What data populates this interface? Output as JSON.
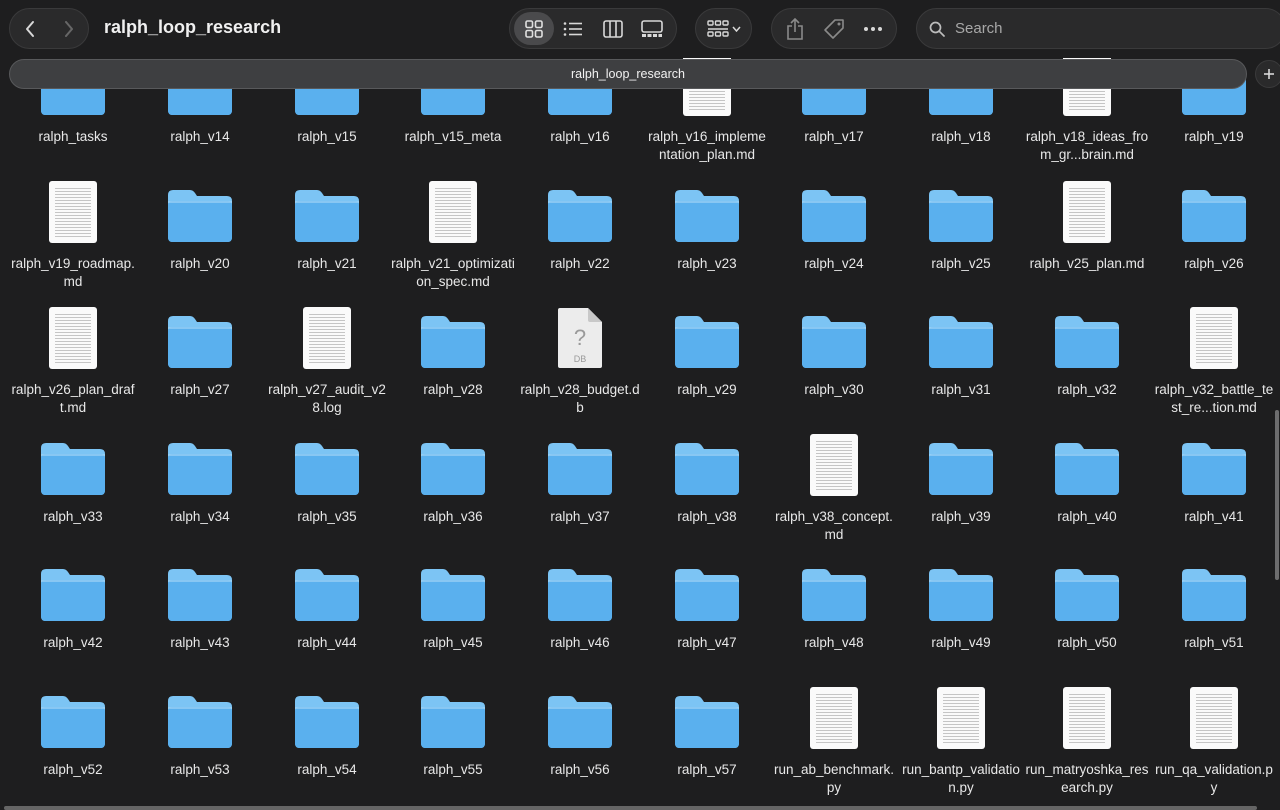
{
  "toolbar": {
    "window_title": "ralph_loop_research",
    "back_icon": "chevron-left-icon",
    "forward_icon": "chevron-right-icon",
    "search_placeholder": "Search"
  },
  "tab": {
    "label": "ralph_loop_research",
    "add_label": "+"
  },
  "colors": {
    "folder": "#5ab0ee",
    "folder_top": "#7cc4f4",
    "background": "#1e1e1f",
    "tabbar": "#3e3f41"
  },
  "rows": [
    [
      {
        "name": "ralph_tasks",
        "kind": "folder"
      },
      {
        "name": "ralph_v14",
        "kind": "folder"
      },
      {
        "name": "ralph_v15",
        "kind": "folder"
      },
      {
        "name": "ralph_v15_meta",
        "kind": "folder"
      },
      {
        "name": "ralph_v16",
        "kind": "folder"
      },
      {
        "name": "ralph_v16_implementation_plan.md",
        "kind": "doc"
      },
      {
        "name": "ralph_v17",
        "kind": "folder"
      },
      {
        "name": "ralph_v18",
        "kind": "folder"
      },
      {
        "name": "ralph_v18_ideas_from_gr...brain.md",
        "kind": "doc"
      },
      {
        "name": "ralph_v19",
        "kind": "folder"
      }
    ],
    [
      {
        "name": "ralph_v19_roadmap.md",
        "kind": "doc"
      },
      {
        "name": "ralph_v20",
        "kind": "folder"
      },
      {
        "name": "ralph_v21",
        "kind": "folder"
      },
      {
        "name": "ralph_v21_optimization_spec.md",
        "kind": "doc"
      },
      {
        "name": "ralph_v22",
        "kind": "folder"
      },
      {
        "name": "ralph_v23",
        "kind": "folder"
      },
      {
        "name": "ralph_v24",
        "kind": "folder"
      },
      {
        "name": "ralph_v25",
        "kind": "folder"
      },
      {
        "name": "ralph_v25_plan.md",
        "kind": "doc"
      },
      {
        "name": "ralph_v26",
        "kind": "folder"
      }
    ],
    [
      {
        "name": "ralph_v26_plan_draft.md",
        "kind": "doc"
      },
      {
        "name": "ralph_v27",
        "kind": "folder"
      },
      {
        "name": "ralph_v27_audit_v28.log",
        "kind": "doc"
      },
      {
        "name": "ralph_v28",
        "kind": "folder"
      },
      {
        "name": "ralph_v28_budget.db",
        "kind": "db",
        "icon_text": "DB",
        "icon_glyph": "?"
      },
      {
        "name": "ralph_v29",
        "kind": "folder"
      },
      {
        "name": "ralph_v30",
        "kind": "folder"
      },
      {
        "name": "ralph_v31",
        "kind": "folder"
      },
      {
        "name": "ralph_v32",
        "kind": "folder"
      },
      {
        "name": "ralph_v32_battle_test_re...tion.md",
        "kind": "doc"
      }
    ],
    [
      {
        "name": "ralph_v33",
        "kind": "folder"
      },
      {
        "name": "ralph_v34",
        "kind": "folder"
      },
      {
        "name": "ralph_v35",
        "kind": "folder"
      },
      {
        "name": "ralph_v36",
        "kind": "folder"
      },
      {
        "name": "ralph_v37",
        "kind": "folder"
      },
      {
        "name": "ralph_v38",
        "kind": "folder"
      },
      {
        "name": "ralph_v38_concept.md",
        "kind": "doc"
      },
      {
        "name": "ralph_v39",
        "kind": "folder"
      },
      {
        "name": "ralph_v40",
        "kind": "folder"
      },
      {
        "name": "ralph_v41",
        "kind": "folder"
      }
    ],
    [
      {
        "name": "ralph_v42",
        "kind": "folder"
      },
      {
        "name": "ralph_v43",
        "kind": "folder"
      },
      {
        "name": "ralph_v44",
        "kind": "folder"
      },
      {
        "name": "ralph_v45",
        "kind": "folder"
      },
      {
        "name": "ralph_v46",
        "kind": "folder"
      },
      {
        "name": "ralph_v47",
        "kind": "folder"
      },
      {
        "name": "ralph_v48",
        "kind": "folder"
      },
      {
        "name": "ralph_v49",
        "kind": "folder"
      },
      {
        "name": "ralph_v50",
        "kind": "folder"
      },
      {
        "name": "ralph_v51",
        "kind": "folder"
      }
    ],
    [
      {
        "name": "ralph_v52",
        "kind": "folder"
      },
      {
        "name": "ralph_v53",
        "kind": "folder"
      },
      {
        "name": "ralph_v54",
        "kind": "folder"
      },
      {
        "name": "ralph_v55",
        "kind": "folder"
      },
      {
        "name": "ralph_v56",
        "kind": "folder"
      },
      {
        "name": "ralph_v57",
        "kind": "folder"
      },
      {
        "name": "run_ab_benchmark.py",
        "kind": "doc"
      },
      {
        "name": "run_bantp_validation.py",
        "kind": "doc"
      },
      {
        "name": "run_matryoshka_research.py",
        "kind": "doc"
      },
      {
        "name": "run_qa_validation.py",
        "kind": "doc"
      }
    ]
  ]
}
